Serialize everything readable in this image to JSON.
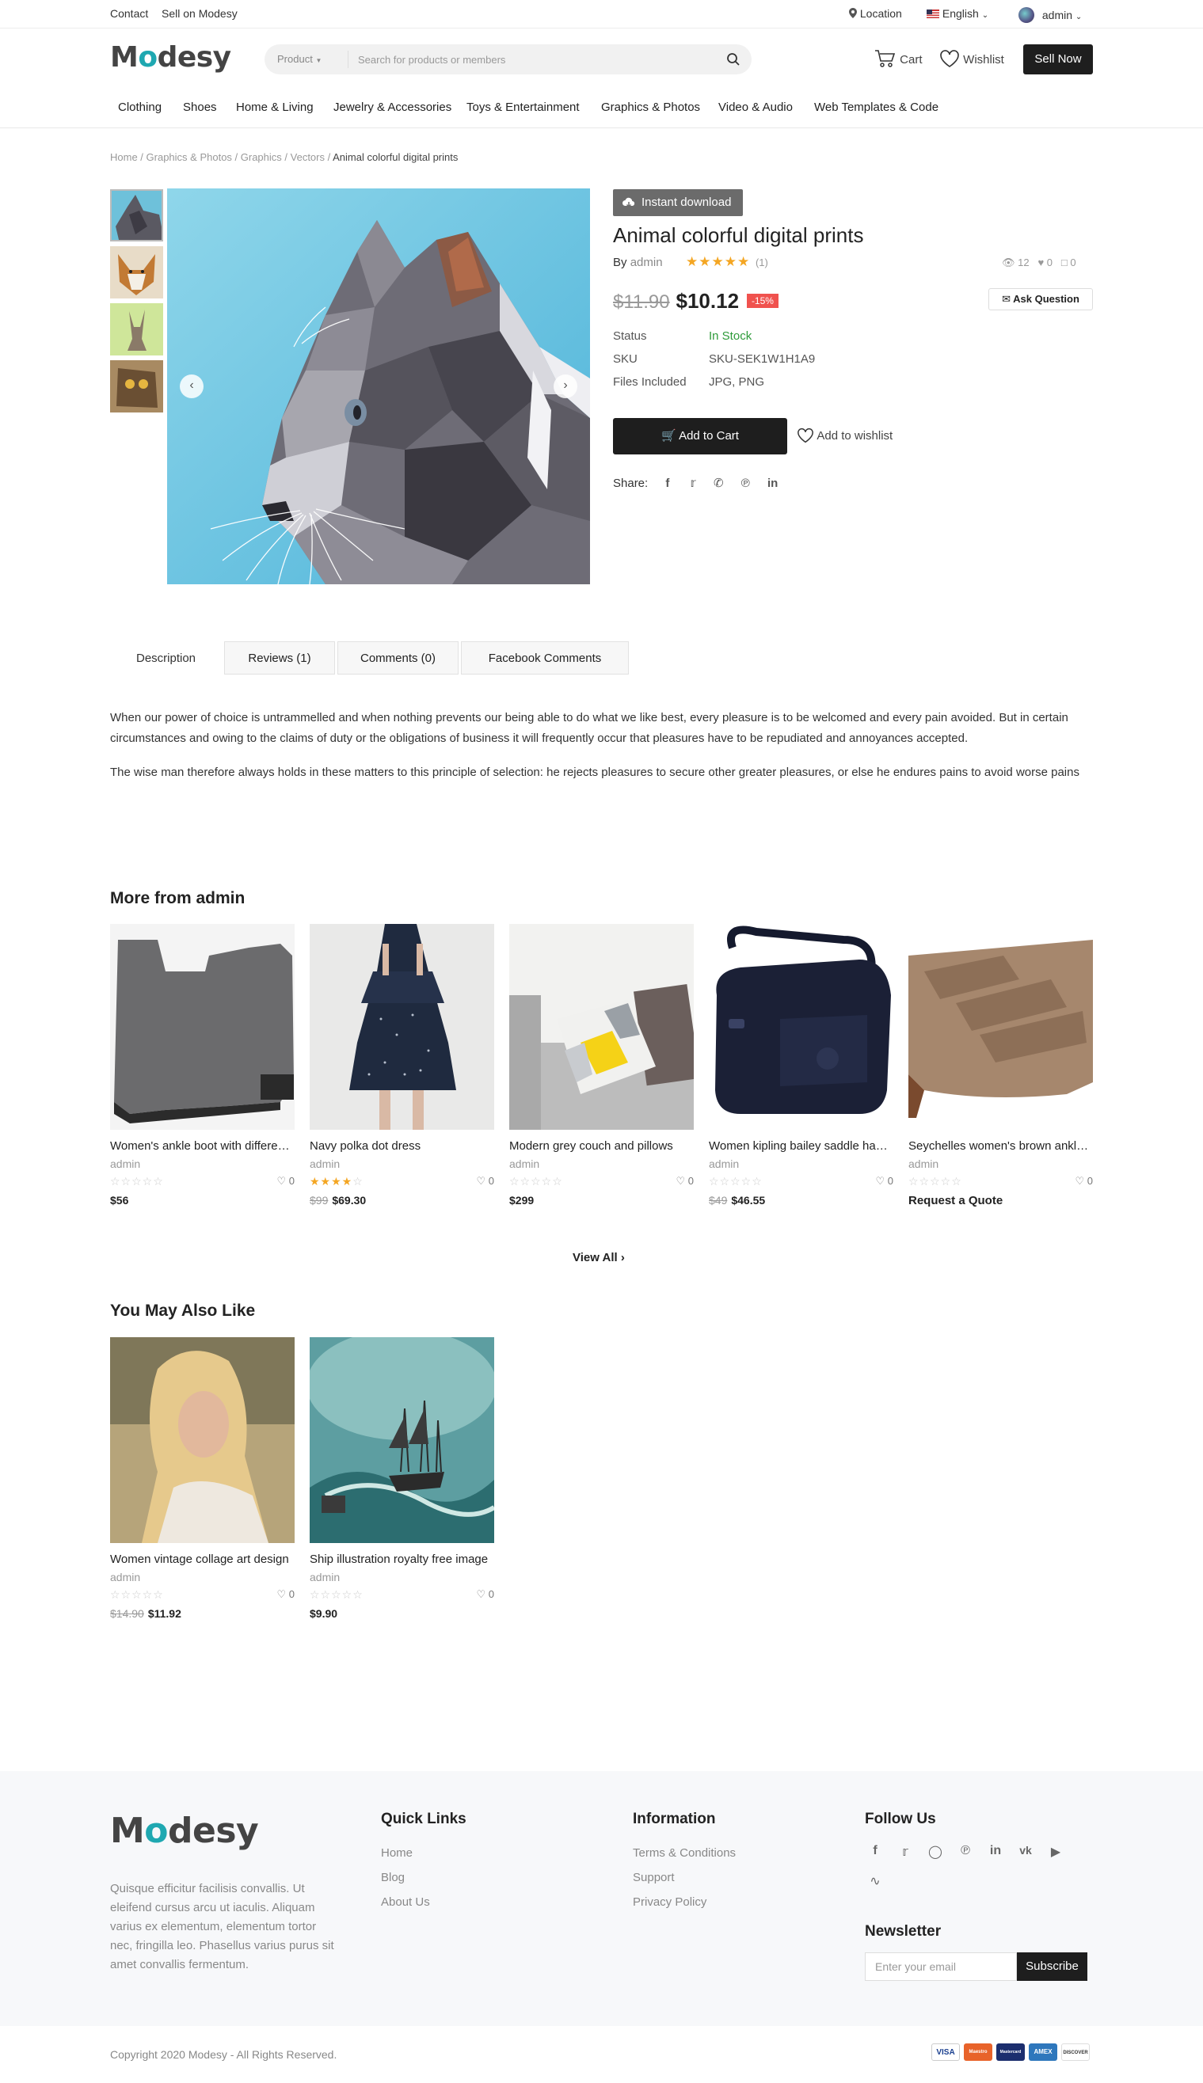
{
  "topbar": {
    "contact": "Contact",
    "sell": "Sell on Modesy",
    "location": "Location",
    "language": "English",
    "user": "admin"
  },
  "header": {
    "logo_m": "M",
    "logo_o": "o",
    "logo_rest": "desy",
    "search_category": "Product",
    "search_placeholder": "Search for products or members",
    "cart": "Cart",
    "wishlist": "Wishlist",
    "sell_now": "Sell Now"
  },
  "nav": [
    "Clothing",
    "Shoes",
    "Home & Living",
    "Jewelry & Accessories",
    "Toys & Entertainment",
    "Graphics & Photos",
    "Video & Audio",
    "Web Templates & Code"
  ],
  "breadcrumb": {
    "items": [
      "Home",
      "Graphics & Photos",
      "Graphics",
      "Vectors"
    ],
    "current": "Animal colorful digital prints"
  },
  "product": {
    "badge": "Instant download",
    "title": "Animal colorful digital prints",
    "by_label": "By",
    "seller": "admin",
    "rating": 5,
    "rating_count": "(1)",
    "views": "12",
    "likes": "0",
    "comments": "0",
    "old_price": "$11.90",
    "price": "$10.12",
    "discount": "-15%",
    "ask_question": "Ask Question",
    "status_label": "Status",
    "status_value": "In Stock",
    "sku_label": "SKU",
    "sku_value": "SKU-SEK1W1H1A9",
    "files_label": "Files Included",
    "files_value": "JPG, PNG",
    "add_to_cart": "Add to Cart",
    "add_to_wishlist": "Add to wishlist",
    "share_label": "Share:"
  },
  "tabs": [
    "Description",
    "Reviews (1)",
    "Comments (0)",
    "Facebook Comments"
  ],
  "description": [
    "When our power of choice is untrammelled and when nothing prevents our being able to do what we like best, every pleasure is to be welcomed and every pain avoided. But in certain circumstances and owing to the claims of duty or the obligations of business it will frequently occur that pleasures have to be repudiated and annoyances accepted.",
    "The wise man therefore always holds in these matters to this principle of selection: he rejects pleasures to secure other greater pleasures, or else he endures pains to avoid worse pains"
  ],
  "more_from": {
    "title": "More from admin",
    "view_all": "View All",
    "items": [
      {
        "name": "Women's ankle boot with different colors",
        "seller": "admin",
        "rating": 0,
        "likes": "0",
        "old_price": "",
        "price": "$56"
      },
      {
        "name": "Navy polka dot dress",
        "seller": "admin",
        "rating": 4,
        "likes": "0",
        "old_price": "$99",
        "price": "$69.30"
      },
      {
        "name": "Modern grey couch and pillows",
        "seller": "admin",
        "rating": 0,
        "likes": "0",
        "old_price": "",
        "price": "$299"
      },
      {
        "name": "Women kipling bailey saddle handbag",
        "seller": "admin",
        "rating": 0,
        "likes": "0",
        "old_price": "$49",
        "price": "$46.55"
      },
      {
        "name": "Seychelles women's brown ankle boots",
        "seller": "admin",
        "rating": 0,
        "likes": "0",
        "old_price": "",
        "price": "Request a Quote"
      }
    ]
  },
  "also_like": {
    "title": "You May Also Like",
    "items": [
      {
        "name": "Women vintage collage art design",
        "seller": "admin",
        "rating": 0,
        "likes": "0",
        "old_price": "$14.90",
        "price": "$11.92"
      },
      {
        "name": "Ship illustration royalty free image",
        "seller": "admin",
        "rating": 0,
        "likes": "0",
        "old_price": "",
        "price": "$9.90"
      }
    ]
  },
  "footer": {
    "about": "Quisque efficitur facilisis convallis. Ut eleifend cursus arcu ut iaculis. Aliquam varius ex elementum, elementum tortor nec, fringilla leo. Phasellus varius purus sit amet convallis fermentum.",
    "quick_links_title": "Quick Links",
    "quick_links": [
      "Home",
      "Blog",
      "About Us"
    ],
    "information_title": "Information",
    "information": [
      "Terms & Conditions",
      "Support",
      "Privacy Policy"
    ],
    "follow_title": "Follow Us",
    "newsletter_title": "Newsletter",
    "newsletter_placeholder": "Enter your email",
    "subscribe": "Subscribe",
    "copyright": "Copyright 2020 Modesy - All Rights Reserved.",
    "payments": [
      "VISA",
      "Maestro",
      "Mastercard",
      "AMEX",
      "DISCOVER"
    ]
  },
  "colors": {
    "accent": "#1fa8b1",
    "star": "#f4a623",
    "in_stock": "#2e9b3a",
    "discount": "#f0524e",
    "dark_button": "#1e1e1e"
  }
}
